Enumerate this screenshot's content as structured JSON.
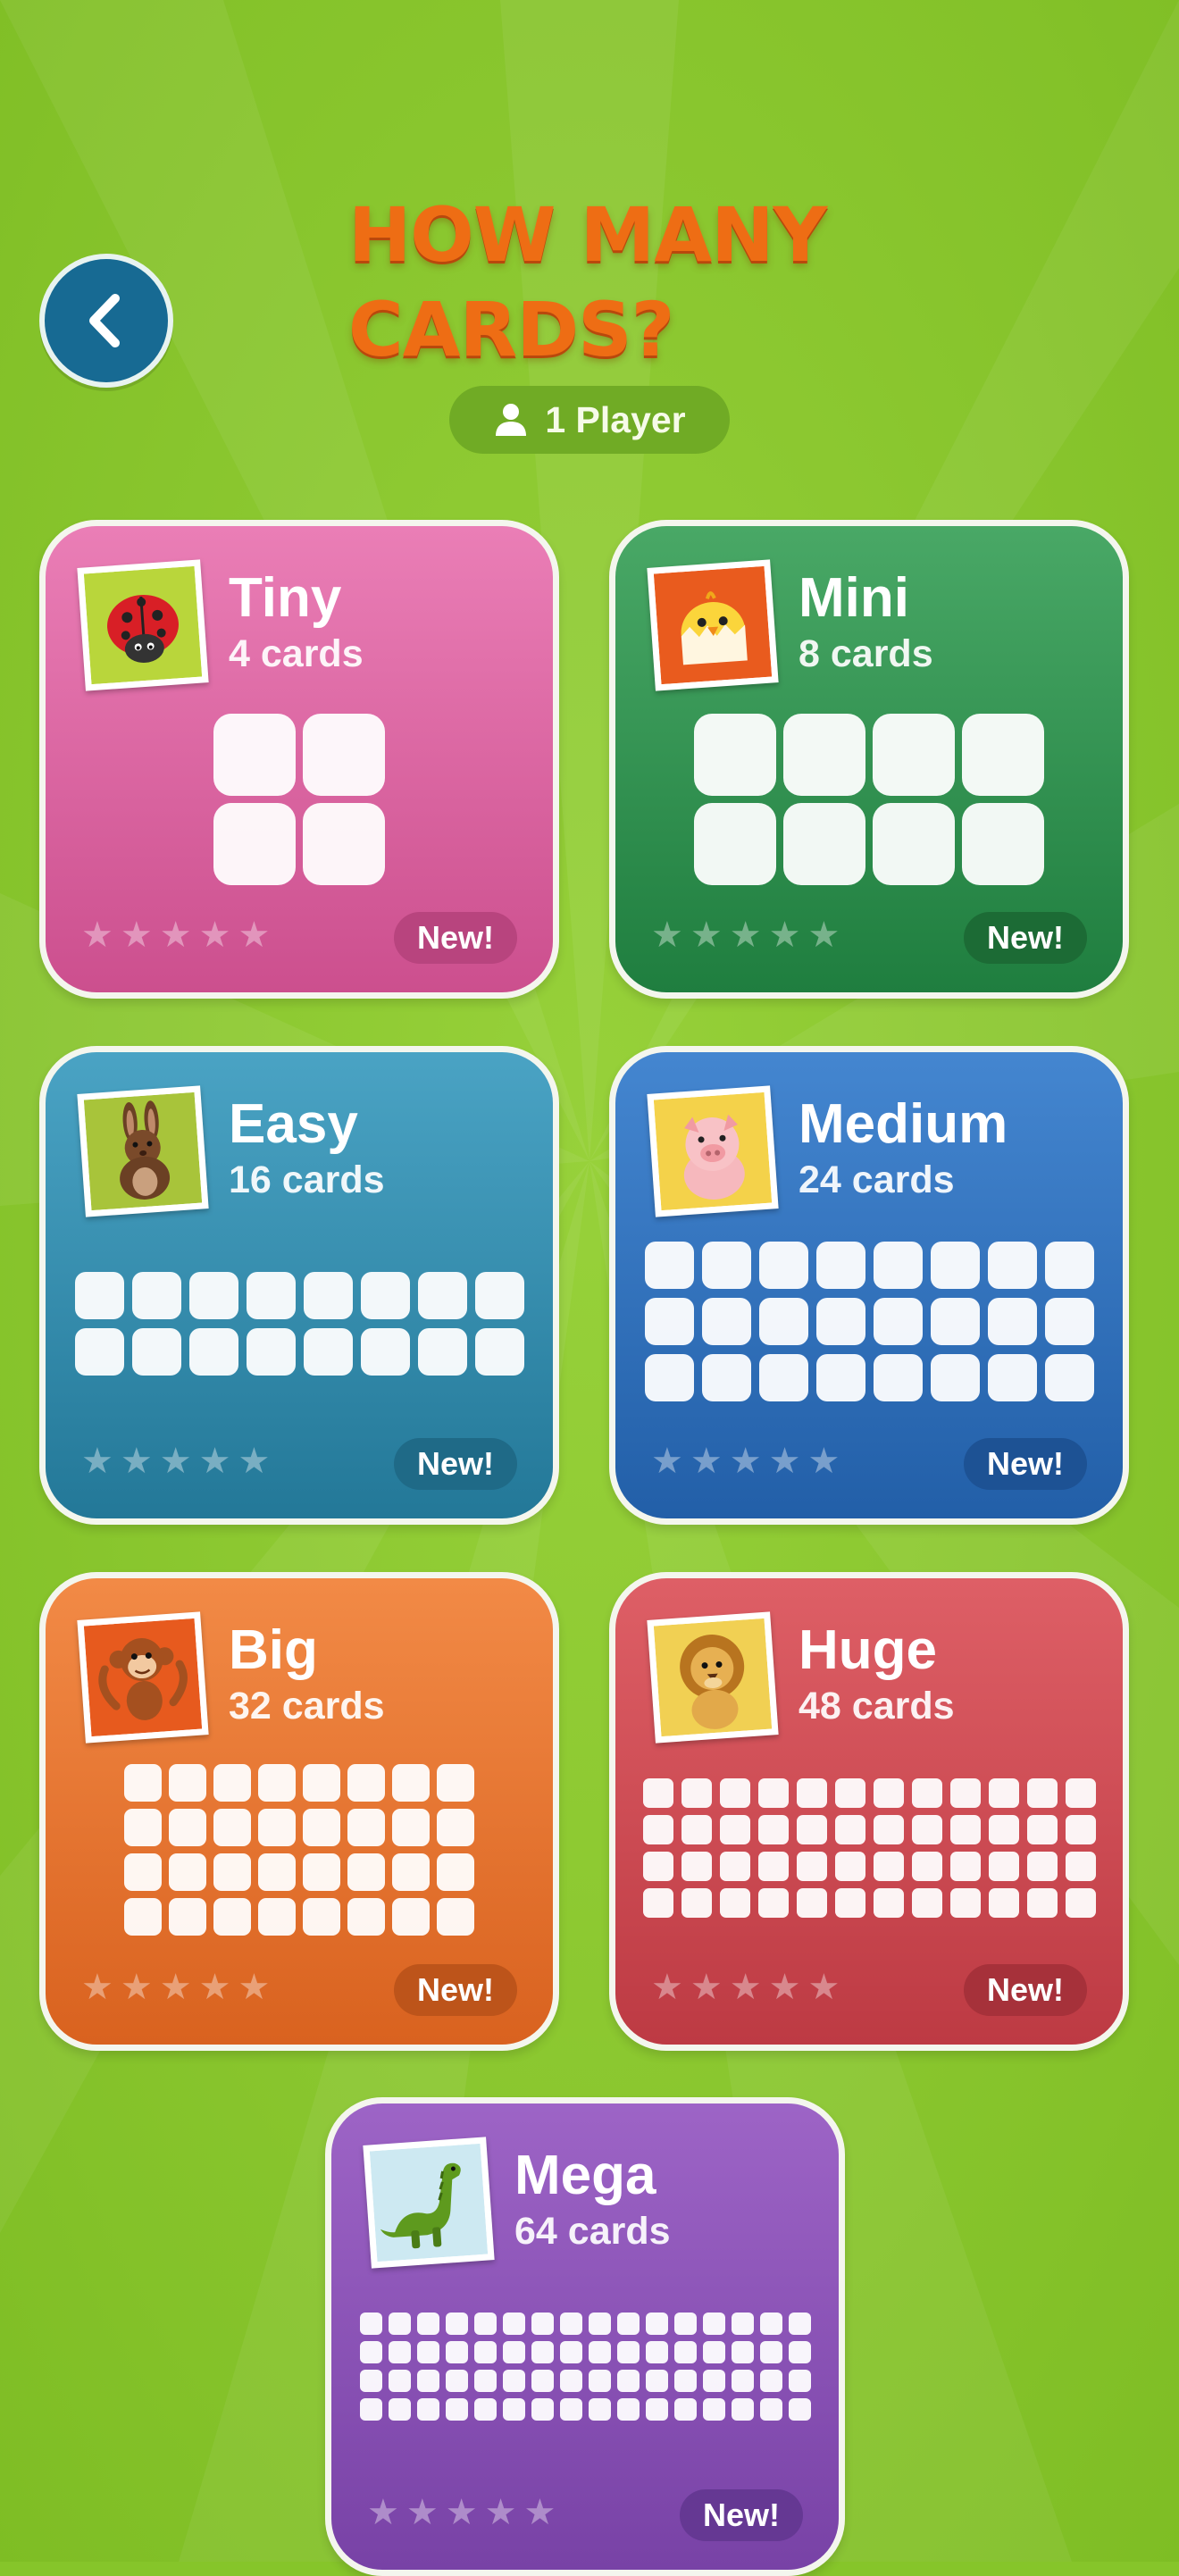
{
  "header": {
    "title": "HOW MANY CARDS?",
    "player_label": "1 Player",
    "back_icon": "chevron-left-icon",
    "player_icon": "person-icon"
  },
  "colors": {
    "background": "#86c52a",
    "title": "#ee6d14",
    "back_button": "#176a93"
  },
  "star_glyph": "★",
  "cards": [
    {
      "name": "Tiny",
      "count": "4 cards",
      "new": "New!",
      "stars": 5,
      "animal": "ladybug-icon",
      "color": "#e06aa6",
      "thumb_bg": "#b9d63b"
    },
    {
      "name": "Mini",
      "count": "8 cards",
      "new": "New!",
      "stars": 5,
      "animal": "chick-icon",
      "color": "#2f9550",
      "thumb_bg": "#e95b1e"
    },
    {
      "name": "Easy",
      "count": "16 cards",
      "new": "New!",
      "stars": 5,
      "animal": "rabbit-icon",
      "color": "#338fb3",
      "thumb_bg": "#a8c43a"
    },
    {
      "name": "Medium",
      "count": "24 cards",
      "new": "New!",
      "stars": 5,
      "animal": "pig-icon",
      "color": "#2f72c0",
      "thumb_bg": "#f4d24a"
    },
    {
      "name": "Big",
      "count": "32 cards",
      "new": "New!",
      "stars": 5,
      "animal": "monkey-icon",
      "color": "#ec7a34",
      "thumb_bg": "#e75a1e"
    },
    {
      "name": "Huge",
      "count": "48 cards",
      "new": "New!",
      "stars": 5,
      "animal": "lion-icon",
      "color": "#d44c54",
      "thumb_bg": "#f1d053"
    },
    {
      "name": "Mega",
      "count": "64 cards",
      "new": "New!",
      "stars": 5,
      "animal": "dinosaur-icon",
      "color": "#8c52b8",
      "thumb_bg": "#cde9f2"
    }
  ]
}
